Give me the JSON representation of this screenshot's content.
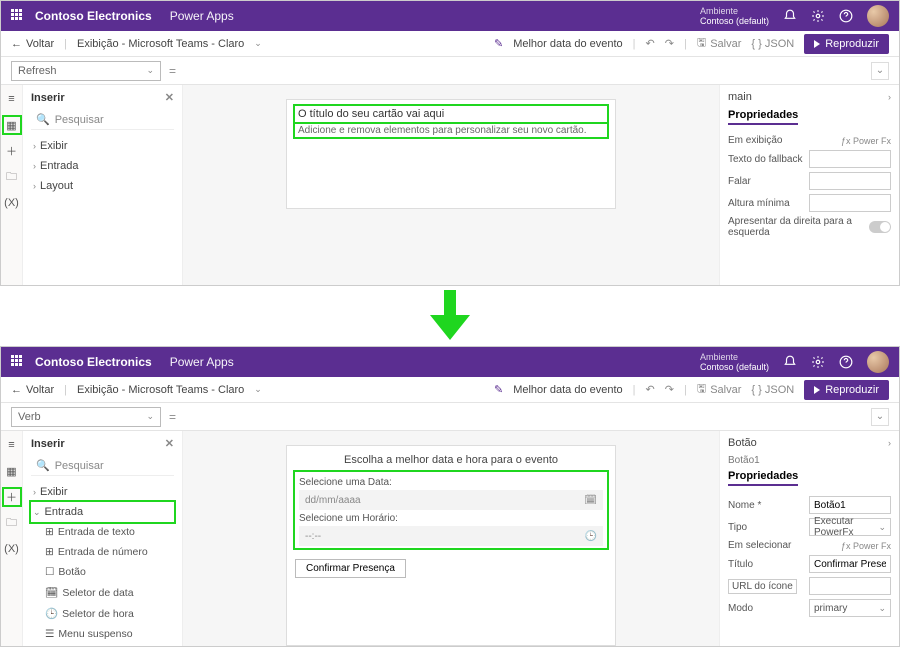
{
  "header": {
    "brand": "Contoso Electronics",
    "product": "Power Apps",
    "env_label": "Ambiente",
    "env_value": "Contoso (default)"
  },
  "cmdbar": {
    "back": "Voltar",
    "crumb": "Exibição - Microsoft Teams - Claro",
    "best": "Melhor data do evento",
    "save": "Salvar",
    "json": "{ } JSON",
    "play": "Reproduzir"
  },
  "fbar1": {
    "selector": "Refresh"
  },
  "fbar2": {
    "selector": "Verb"
  },
  "leftpane": {
    "title": "Inserir",
    "search_ph": "Pesquisar",
    "items": [
      "Exibir",
      "Entrada",
      "Layout"
    ],
    "subitems": [
      "Entrada de texto",
      "Entrada de número",
      "Botão",
      "Seletor de data",
      "Seletor de hora",
      "Menu suspenso"
    ]
  },
  "card1": {
    "title": "O título do seu cartão vai aqui",
    "subtitle": "Adicione e remova elementos para personalizar seu novo cartão."
  },
  "right1": {
    "heading": "main",
    "tab": "Propriedades",
    "rows": {
      "em_exibicao": "Em exibição",
      "powerfx": "Power Fx",
      "fallback": "Texto do fallback",
      "falar": "Falar",
      "altura": "Altura mínima",
      "rtl": "Apresentar da direita para a esquerda"
    }
  },
  "card2": {
    "heading": "Escolha a melhor data e hora para o evento",
    "date_label": "Selecione uma Data:",
    "date_ph": "dd/mm/aaaa",
    "time_label": "Selecione um Horário:",
    "time_ph": "--:--",
    "confirm": "Confirmar Presença"
  },
  "right2": {
    "heading": "Botão",
    "sub": "Botão1",
    "tab": "Propriedades",
    "rows": {
      "nome": "Nome *",
      "nome_v": "Botão1",
      "tipo": "Tipo",
      "tipo_v": "Executar PowerFx",
      "emsel": "Em selecionar",
      "powerfx": "Power Fx",
      "titulo": "Título",
      "titulo_v": "Confirmar Presença",
      "url": "URL do ícone",
      "modo": "Modo",
      "modo_v": "primary"
    }
  }
}
